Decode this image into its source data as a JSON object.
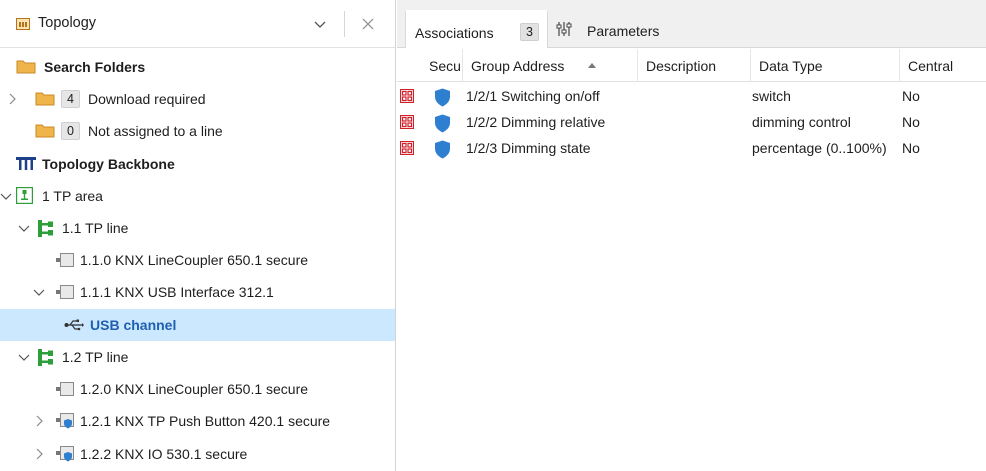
{
  "left_panel": {
    "title": "Topology",
    "tree": [
      {
        "name": "tree-item-search-folders",
        "label": "Search Folders",
        "badge": null,
        "bold": true,
        "selected": false
      },
      {
        "name": "tree-item-download-required",
        "label": "Download required",
        "badge": "4",
        "bold": false,
        "selected": false
      },
      {
        "name": "tree-item-not-assigned",
        "label": "Not assigned to a line",
        "badge": "0",
        "bold": false,
        "selected": false
      },
      {
        "name": "tree-item-topology-backbone",
        "label": "Topology Backbone",
        "badge": null,
        "bold": true,
        "selected": false
      },
      {
        "name": "tree-item-tp-area",
        "label": "1 TP area",
        "badge": null,
        "bold": false,
        "selected": false
      },
      {
        "name": "tree-item-line-1-1",
        "label": "1.1 TP line",
        "badge": null,
        "bold": false,
        "selected": false
      },
      {
        "name": "tree-item-device-1-1-0",
        "label": "1.1.0 KNX LineCoupler 650.1 secure",
        "badge": null,
        "bold": false,
        "selected": false
      },
      {
        "name": "tree-item-device-1-1-1",
        "label": "1.1.1 KNX USB Interface 312.1",
        "badge": null,
        "bold": false,
        "selected": false
      },
      {
        "name": "tree-item-usb-channel",
        "label": "USB channel",
        "badge": null,
        "bold": true,
        "selected": true
      },
      {
        "name": "tree-item-line-1-2",
        "label": "1.2 TP line",
        "badge": null,
        "bold": false,
        "selected": false
      },
      {
        "name": "tree-item-device-1-2-0",
        "label": "1.2.0 KNX LineCoupler 650.1 secure",
        "badge": null,
        "bold": false,
        "selected": false
      },
      {
        "name": "tree-item-device-1-2-1",
        "label": "1.2.1 KNX TP Push Button 420.1 secure",
        "badge": null,
        "bold": false,
        "selected": false
      },
      {
        "name": "tree-item-device-1-2-2",
        "label": "1.2.2 KNX IO 530.1 secure",
        "badge": null,
        "bold": false,
        "selected": false
      }
    ]
  },
  "right_panel": {
    "tabs": [
      {
        "label": "Associations",
        "count": "3",
        "active": true
      },
      {
        "label": "Parameters",
        "count": null,
        "active": false
      }
    ],
    "columns": [
      "Secu",
      "Group Address",
      "Description",
      "Data Type",
      "Central"
    ],
    "rows": [
      {
        "group_address": "1/2/1 Switching on/off",
        "description": "",
        "data_type": "switch",
        "central": "No"
      },
      {
        "group_address": "1/2/2 Dimming relative",
        "description": "",
        "data_type": "dimming control",
        "central": "No"
      },
      {
        "group_address": "1/2/3 Dimming state",
        "description": "",
        "data_type": "percentage (0..100%)",
        "central": "No"
      }
    ]
  },
  "colors": {
    "selection": "#cce8ff",
    "line_green": "#2e9e3a",
    "shield_blue": "#2f7fd1",
    "object_red": "#d0202a",
    "folder_orange": "#e8a33d"
  }
}
